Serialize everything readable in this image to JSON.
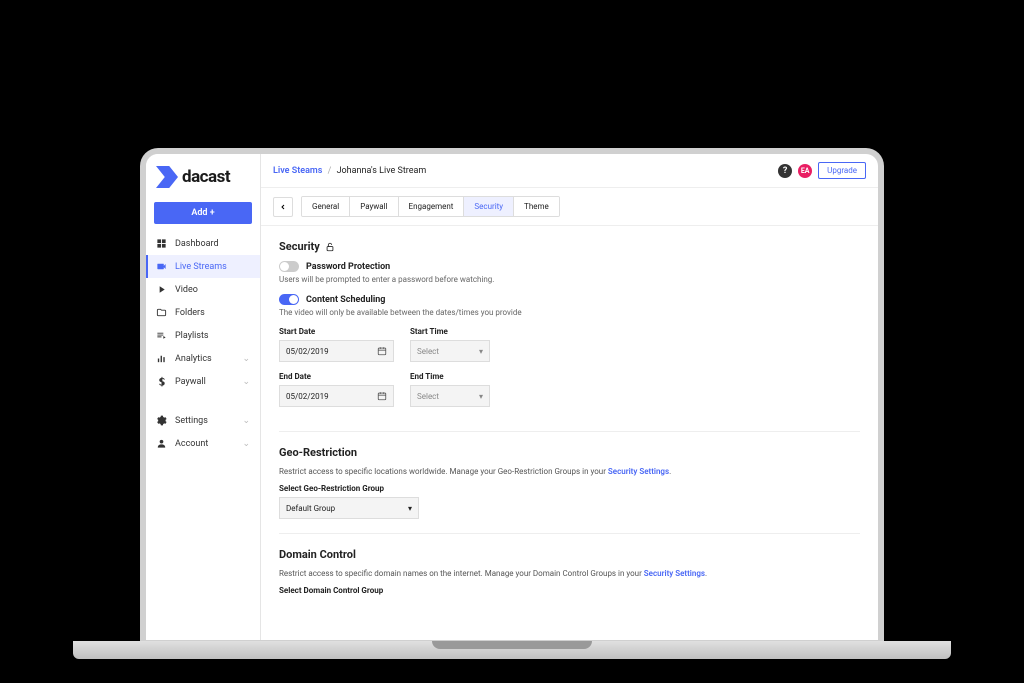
{
  "brand": {
    "name": "dacast"
  },
  "sidebar": {
    "add_button": "Add +",
    "items": [
      {
        "label": "Dashboard",
        "icon": "dashboard"
      },
      {
        "label": "Live Streams",
        "icon": "camera",
        "active": true
      },
      {
        "label": "Video",
        "icon": "play"
      },
      {
        "label": "Folders",
        "icon": "folder"
      },
      {
        "label": "Playlists",
        "icon": "playlist"
      },
      {
        "label": "Analytics",
        "icon": "analytics",
        "expandable": true
      },
      {
        "label": "Paywall",
        "icon": "dollar",
        "expandable": true
      }
    ],
    "bottom_items": [
      {
        "label": "Settings",
        "icon": "gear",
        "expandable": true
      },
      {
        "label": "Account",
        "icon": "person",
        "expandable": true
      }
    ]
  },
  "topbar": {
    "breadcrumb_root": "Live Steams",
    "breadcrumb_current": "Johanna's Live Stream",
    "avatar_initials": "EA",
    "upgrade_label": "Upgrade"
  },
  "tabs": {
    "items": [
      "General",
      "Paywall",
      "Engagement",
      "Security",
      "Theme"
    ],
    "active": "Security"
  },
  "security": {
    "title": "Security",
    "password": {
      "label": "Password Protection",
      "desc": "Users will be prompted to enter a password before watching."
    },
    "scheduling": {
      "label": "Content Scheduling",
      "desc": "The video will only be available between the dates/times you provide",
      "start_date_label": "Start Date",
      "start_date_value": "05/02/2019",
      "start_time_label": "Start Time",
      "start_time_placeholder": "Select",
      "end_date_label": "End Date",
      "end_date_value": "05/02/2019",
      "end_time_label": "End Time",
      "end_time_placeholder": "Select"
    }
  },
  "geo": {
    "title": "Geo-Restriction",
    "desc_pre": "Restrict access to specific locations worldwide. Manage your Geo-Restriction Groups in your ",
    "link": "Security Settings",
    "select_label": "Select Geo-Restriction Group",
    "select_value": "Default Group"
  },
  "domain": {
    "title": "Domain Control",
    "desc_pre": "Restrict access to specific domain names on the internet. Manage your Domain Control Groups in your ",
    "link": "Security Settings",
    "select_label": "Select Domain Control Group"
  }
}
